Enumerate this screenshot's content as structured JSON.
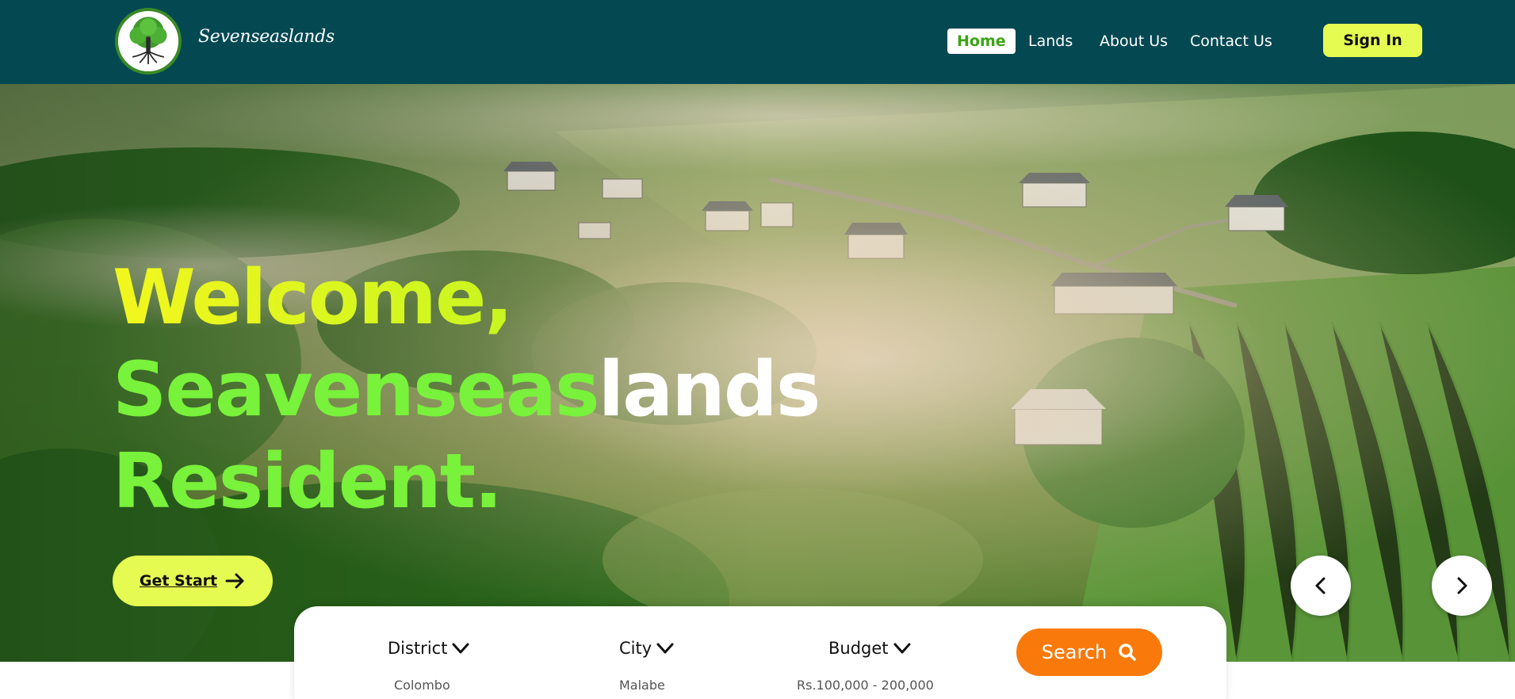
{
  "header": {
    "brand": "Sevenseaslands",
    "nav": [
      {
        "label": "Home",
        "active": true
      },
      {
        "label": "Lands",
        "active": false
      },
      {
        "label": "About Us",
        "active": false
      },
      {
        "label": "Contact Us",
        "active": false
      }
    ],
    "signin_label": "Sign In"
  },
  "hero": {
    "line1": "Welcome,",
    "line2_green": "Seavenseas",
    "line2_white": "lands",
    "line3": "Resident.",
    "cta_label": "Get Start"
  },
  "search": {
    "filters": [
      {
        "label": "District",
        "value": "Colombo"
      },
      {
        "label": "City",
        "value": "Malabe"
      },
      {
        "label": "Budget",
        "value": "Rs.100,000 - 200,000"
      }
    ],
    "button_label": "Search"
  },
  "icons": {
    "logo": "tree-logo-icon",
    "cta": "arrow-right-icon",
    "prev": "chevron-left-icon",
    "next": "chevron-right-icon",
    "dropdown": "chevron-down-icon",
    "search": "search-icon"
  },
  "colors": {
    "header_bg": "#044852",
    "accent_yellow": "#e6fb52",
    "accent_green": "#78f23a",
    "search_orange": "#f97a0b",
    "active_nav_text": "#3aa515"
  }
}
